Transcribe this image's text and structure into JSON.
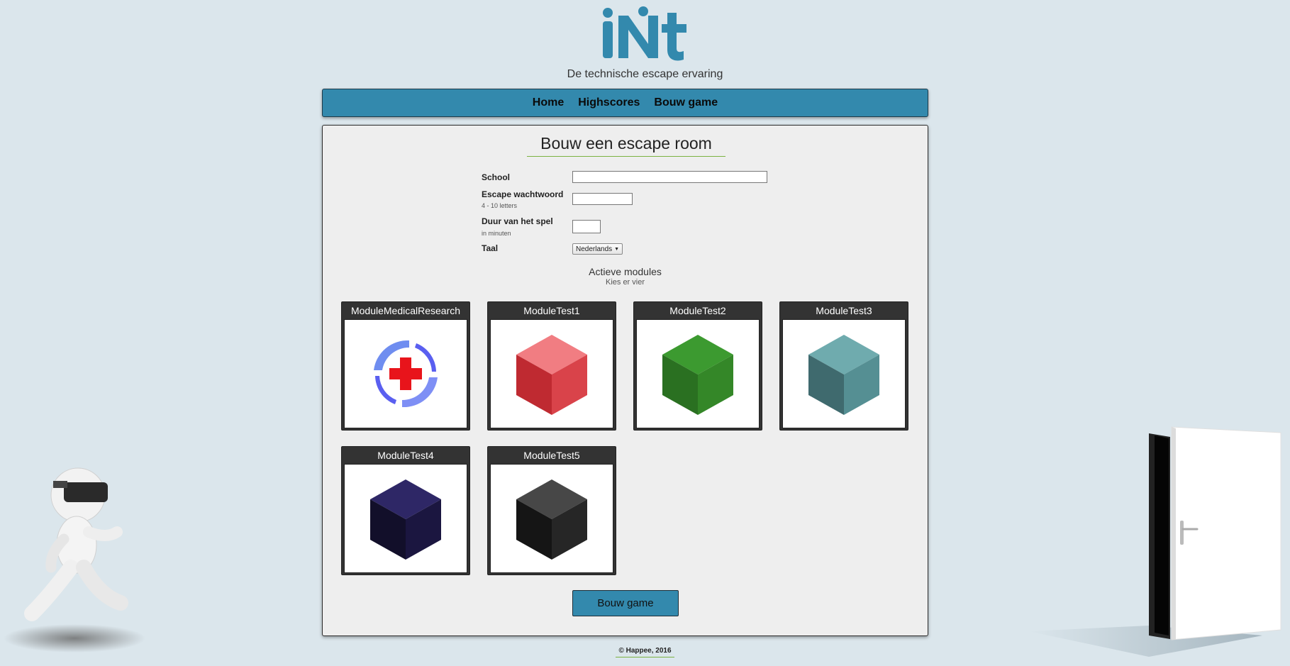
{
  "brand": {
    "logo_text": "iNit",
    "tagline": "De technische escape ervaring",
    "color": "#3389ad"
  },
  "nav": {
    "items": [
      {
        "label": "Home"
      },
      {
        "label": "Highscores"
      },
      {
        "label": "Bouw game"
      }
    ]
  },
  "form": {
    "title": "Bouw een escape room",
    "school": {
      "label": "School",
      "value": ""
    },
    "password": {
      "label": "Escape wachtwoord",
      "hint": "4 - 10 letters",
      "value": ""
    },
    "duration": {
      "label": "Duur van het spel",
      "hint": "in minuten",
      "value": ""
    },
    "language": {
      "label": "Taal",
      "selected": "Nederlands"
    }
  },
  "modules": {
    "title": "Actieve modules",
    "subtitle": "Kies er vier",
    "items": [
      {
        "name": "ModuleMedicalResearch",
        "icon": "medical-cross-icon",
        "color": "#e8141b"
      },
      {
        "name": "ModuleTest1",
        "icon": "red-cube-icon",
        "color": "#d9434a"
      },
      {
        "name": "ModuleTest2",
        "icon": "green-cube-icon",
        "color": "#36922b"
      },
      {
        "name": "ModuleTest3",
        "icon": "teal-cube-icon",
        "color": "#5f9ea2"
      },
      {
        "name": "ModuleTest4",
        "icon": "navy-cube-icon",
        "color": "#1f1a45"
      },
      {
        "name": "ModuleTest5",
        "icon": "black-cube-icon",
        "color": "#2a2a2a"
      }
    ]
  },
  "actions": {
    "build_label": "Bouw game"
  },
  "footer": {
    "text": "© Happee, 2016"
  },
  "decorations": {
    "left": "vr-runner-figure",
    "right": "open-door"
  }
}
